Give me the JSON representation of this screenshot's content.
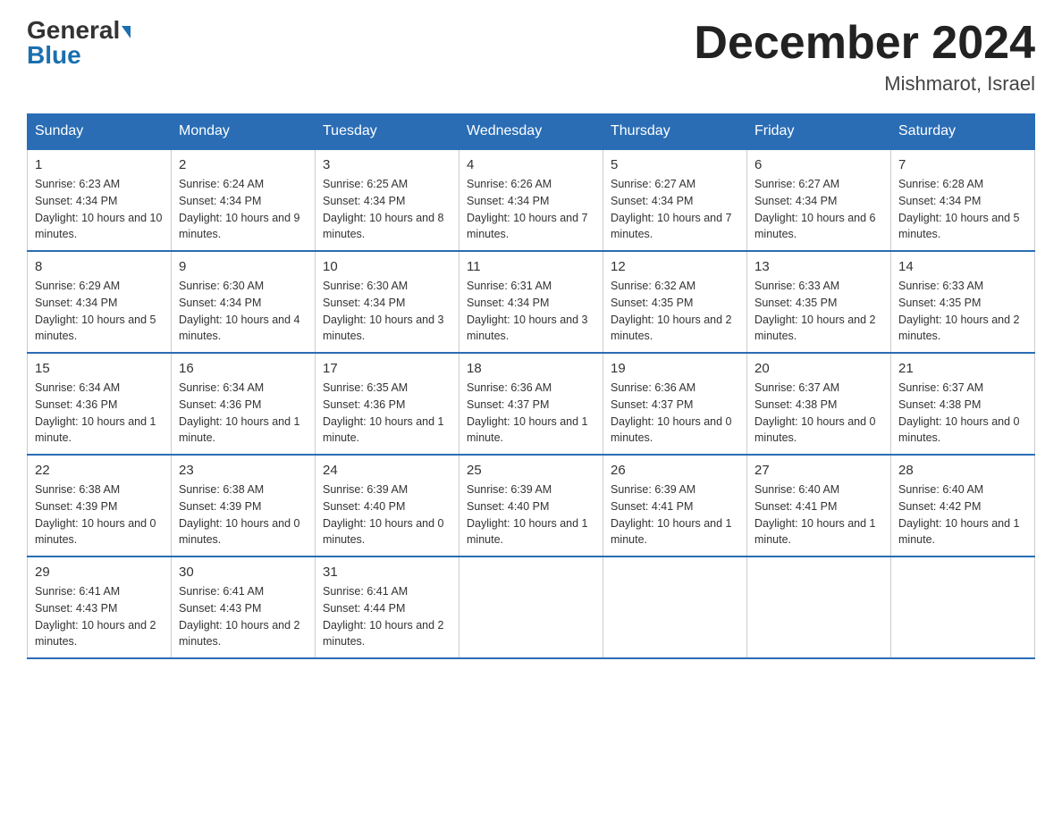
{
  "header": {
    "logo_line1": "General",
    "logo_line2": "Blue",
    "month_title": "December 2024",
    "location": "Mishmarot, Israel"
  },
  "days_of_week": [
    "Sunday",
    "Monday",
    "Tuesday",
    "Wednesday",
    "Thursday",
    "Friday",
    "Saturday"
  ],
  "weeks": [
    [
      {
        "day": "1",
        "sunrise": "6:23 AM",
        "sunset": "4:34 PM",
        "daylight": "10 hours and 10 minutes."
      },
      {
        "day": "2",
        "sunrise": "6:24 AM",
        "sunset": "4:34 PM",
        "daylight": "10 hours and 9 minutes."
      },
      {
        "day": "3",
        "sunrise": "6:25 AM",
        "sunset": "4:34 PM",
        "daylight": "10 hours and 8 minutes."
      },
      {
        "day": "4",
        "sunrise": "6:26 AM",
        "sunset": "4:34 PM",
        "daylight": "10 hours and 7 minutes."
      },
      {
        "day": "5",
        "sunrise": "6:27 AM",
        "sunset": "4:34 PM",
        "daylight": "10 hours and 7 minutes."
      },
      {
        "day": "6",
        "sunrise": "6:27 AM",
        "sunset": "4:34 PM",
        "daylight": "10 hours and 6 minutes."
      },
      {
        "day": "7",
        "sunrise": "6:28 AM",
        "sunset": "4:34 PM",
        "daylight": "10 hours and 5 minutes."
      }
    ],
    [
      {
        "day": "8",
        "sunrise": "6:29 AM",
        "sunset": "4:34 PM",
        "daylight": "10 hours and 5 minutes."
      },
      {
        "day": "9",
        "sunrise": "6:30 AM",
        "sunset": "4:34 PM",
        "daylight": "10 hours and 4 minutes."
      },
      {
        "day": "10",
        "sunrise": "6:30 AM",
        "sunset": "4:34 PM",
        "daylight": "10 hours and 3 minutes."
      },
      {
        "day": "11",
        "sunrise": "6:31 AM",
        "sunset": "4:34 PM",
        "daylight": "10 hours and 3 minutes."
      },
      {
        "day": "12",
        "sunrise": "6:32 AM",
        "sunset": "4:35 PM",
        "daylight": "10 hours and 2 minutes."
      },
      {
        "day": "13",
        "sunrise": "6:33 AM",
        "sunset": "4:35 PM",
        "daylight": "10 hours and 2 minutes."
      },
      {
        "day": "14",
        "sunrise": "6:33 AM",
        "sunset": "4:35 PM",
        "daylight": "10 hours and 2 minutes."
      }
    ],
    [
      {
        "day": "15",
        "sunrise": "6:34 AM",
        "sunset": "4:36 PM",
        "daylight": "10 hours and 1 minute."
      },
      {
        "day": "16",
        "sunrise": "6:34 AM",
        "sunset": "4:36 PM",
        "daylight": "10 hours and 1 minute."
      },
      {
        "day": "17",
        "sunrise": "6:35 AM",
        "sunset": "4:36 PM",
        "daylight": "10 hours and 1 minute."
      },
      {
        "day": "18",
        "sunrise": "6:36 AM",
        "sunset": "4:37 PM",
        "daylight": "10 hours and 1 minute."
      },
      {
        "day": "19",
        "sunrise": "6:36 AM",
        "sunset": "4:37 PM",
        "daylight": "10 hours and 0 minutes."
      },
      {
        "day": "20",
        "sunrise": "6:37 AM",
        "sunset": "4:38 PM",
        "daylight": "10 hours and 0 minutes."
      },
      {
        "day": "21",
        "sunrise": "6:37 AM",
        "sunset": "4:38 PM",
        "daylight": "10 hours and 0 minutes."
      }
    ],
    [
      {
        "day": "22",
        "sunrise": "6:38 AM",
        "sunset": "4:39 PM",
        "daylight": "10 hours and 0 minutes."
      },
      {
        "day": "23",
        "sunrise": "6:38 AM",
        "sunset": "4:39 PM",
        "daylight": "10 hours and 0 minutes."
      },
      {
        "day": "24",
        "sunrise": "6:39 AM",
        "sunset": "4:40 PM",
        "daylight": "10 hours and 0 minutes."
      },
      {
        "day": "25",
        "sunrise": "6:39 AM",
        "sunset": "4:40 PM",
        "daylight": "10 hours and 1 minute."
      },
      {
        "day": "26",
        "sunrise": "6:39 AM",
        "sunset": "4:41 PM",
        "daylight": "10 hours and 1 minute."
      },
      {
        "day": "27",
        "sunrise": "6:40 AM",
        "sunset": "4:41 PM",
        "daylight": "10 hours and 1 minute."
      },
      {
        "day": "28",
        "sunrise": "6:40 AM",
        "sunset": "4:42 PM",
        "daylight": "10 hours and 1 minute."
      }
    ],
    [
      {
        "day": "29",
        "sunrise": "6:41 AM",
        "sunset": "4:43 PM",
        "daylight": "10 hours and 2 minutes."
      },
      {
        "day": "30",
        "sunrise": "6:41 AM",
        "sunset": "4:43 PM",
        "daylight": "10 hours and 2 minutes."
      },
      {
        "day": "31",
        "sunrise": "6:41 AM",
        "sunset": "4:44 PM",
        "daylight": "10 hours and 2 minutes."
      },
      null,
      null,
      null,
      null
    ]
  ]
}
